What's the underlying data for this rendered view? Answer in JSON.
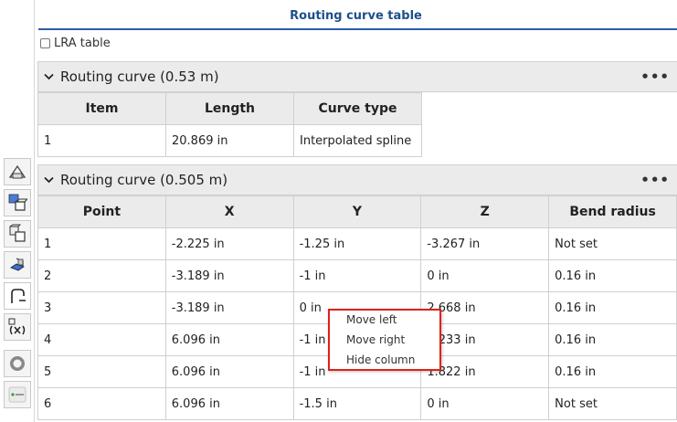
{
  "panel": {
    "title": "Routing curve table",
    "lra_label": "LRA table",
    "lra_checked": false
  },
  "section1": {
    "title": "Routing curve (0.53 m)",
    "menu": "•••",
    "columns": [
      "Item",
      "Length",
      "Curve type"
    ],
    "rows": [
      [
        "1",
        "20.869 in",
        "Interpolated spline"
      ]
    ]
  },
  "section2": {
    "title": "Routing curve (0.505 m)",
    "menu": "•••",
    "columns": [
      "Point",
      "X",
      "Y",
      "Z",
      "Bend radius"
    ],
    "rows": [
      [
        "1",
        "-2.225 in",
        "-1.25 in",
        "-3.267 in",
        "Not set"
      ],
      [
        "2",
        "-3.189 in",
        "-1 in",
        "0 in",
        "0.16 in"
      ],
      [
        "3",
        "-3.189 in",
        "0 in",
        "2.668 in",
        "0.16 in"
      ],
      [
        "4",
        "6.096 in",
        "-1 in",
        "2.233 in",
        "0.16 in"
      ],
      [
        "5",
        "6.096 in",
        "-1 in",
        "1.822 in",
        "0.16 in"
      ],
      [
        "6",
        "6.096 in",
        "-1.5 in",
        "0 in",
        "Not set"
      ]
    ]
  },
  "context_menu": {
    "items": [
      "Move left",
      "Move right",
      "Hide column"
    ],
    "border_color": "#e0201b"
  },
  "toolbar": {
    "icons": [
      "part-studio-icon",
      "assembly-icon",
      "multi-part-icon",
      "sheet-metal-icon",
      "routing-curve-icon",
      "variable-icon",
      "circle-icon",
      "app-icon"
    ]
  },
  "colors": {
    "title": "#1d4f8c",
    "accent_line": "#2a5ea8",
    "header_bg": "#ebebeb"
  }
}
